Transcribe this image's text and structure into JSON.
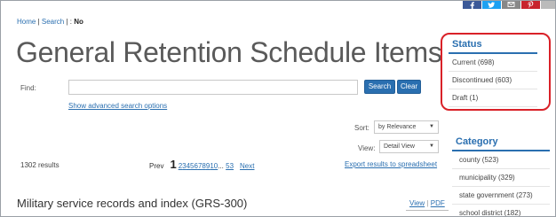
{
  "breadcrumb": {
    "home": "Home",
    "sep1": " | ",
    "search": "Search",
    "sep2": " | : ",
    "current": "No"
  },
  "page_title": "General Retention Schedule Items",
  "search": {
    "find_label": "Find:",
    "value": "",
    "placeholder": "",
    "search_button": "Search",
    "clear_button": "Clear",
    "advanced_link": "Show advanced search options"
  },
  "controls": {
    "sort_label": "Sort:",
    "sort_value": "by Relevance",
    "view_label": "View:",
    "view_value": "Detail View"
  },
  "results": {
    "count": "1302 results",
    "prev": "Prev",
    "current_page": "1",
    "pages": [
      "2",
      "3",
      "4",
      "5",
      "6",
      "7",
      "8",
      "9",
      "10"
    ],
    "ellipsis": "...",
    "last_page": "53",
    "next": "Next",
    "export": "Export results to spreadsheet"
  },
  "first_item": {
    "title": "Military service records and index (GRS-300)",
    "view": "View",
    "sep": " | ",
    "pdf": "PDF"
  },
  "status_facet": {
    "heading": "Status",
    "items": [
      "Current (698)",
      "Discontinued (603)",
      "Draft (1)"
    ]
  },
  "category_facet": {
    "heading": "Category",
    "items": [
      "county (523)",
      "municipality (329)",
      "state government (273)",
      "school district (182)"
    ]
  },
  "social_icons": [
    "facebook-icon",
    "twitter-icon",
    "mail-icon",
    "pinterest-icon"
  ],
  "colors": {
    "link": "#2a6fb0",
    "button": "#2a6fb0",
    "annotation": "#d92128"
  }
}
